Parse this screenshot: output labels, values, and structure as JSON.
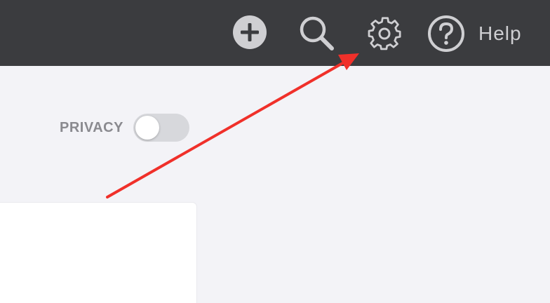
{
  "topbar": {
    "icons": {
      "add": "plus-circle-icon",
      "search": "search-icon",
      "settings": "gear-icon",
      "help": "question-circle-icon"
    },
    "help_label": "Help"
  },
  "privacy": {
    "label": "PRIVACY",
    "enabled": false
  },
  "annotation": {
    "type": "arrow",
    "color": "#f0302a",
    "target": "settings"
  },
  "colors": {
    "topbar_bg": "#3b3c3f",
    "page_bg": "#f3f3f7",
    "icon": "#cfcfd2",
    "toggle_off": "#d7d8dc"
  }
}
